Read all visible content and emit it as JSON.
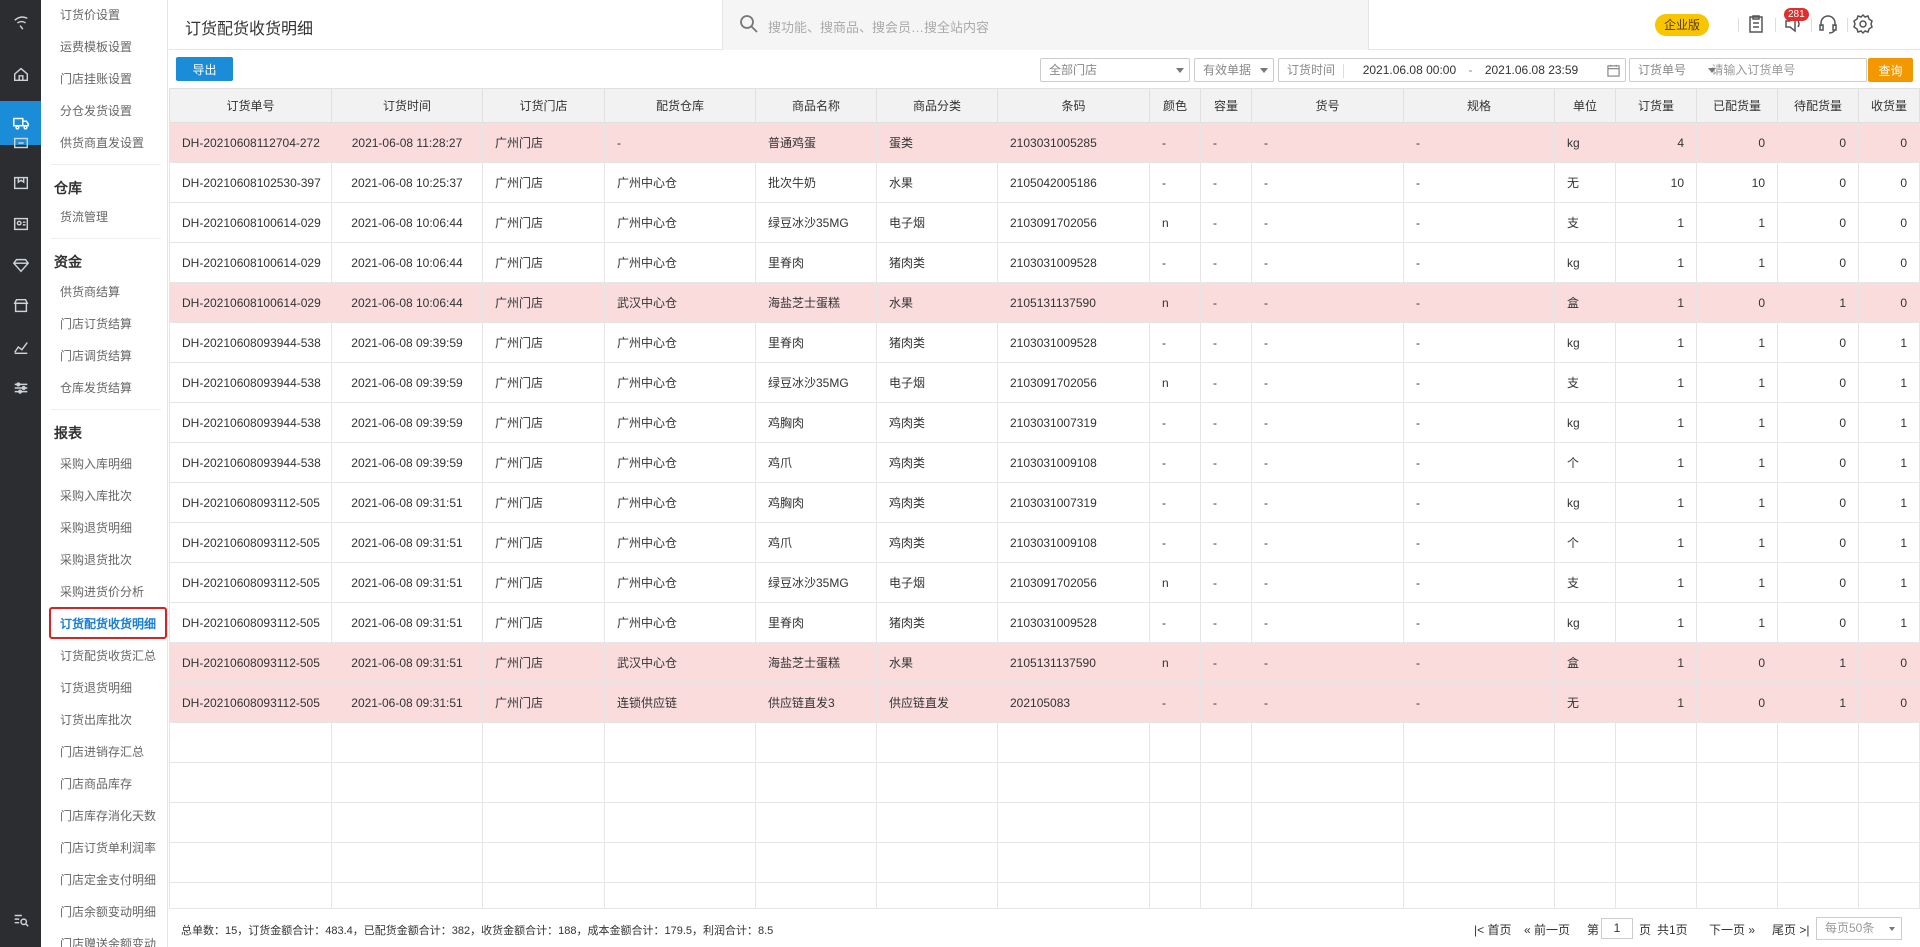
{
  "header": {
    "title": "订货配货收货明细",
    "search_placeholder": "搜功能、搜商品、搜会员…搜全站内容",
    "edition_badge": "企业版",
    "message_count": "281"
  },
  "sidebar": {
    "items_top": [
      "订货价设置",
      "运费模板设置",
      "门店挂账设置",
      "分仓发货设置",
      "供货商直发设置"
    ],
    "group_warehouse": "仓库",
    "items_warehouse": [
      "货流管理"
    ],
    "group_funds": "资金",
    "items_funds": [
      "供货商结算",
      "门店订货结算",
      "门店调货结算",
      "仓库发货结算"
    ],
    "group_reports": "报表",
    "items_reports": [
      "采购入库明细",
      "采购入库批次",
      "采购退货明细",
      "采购退货批次",
      "采购进货价分析"
    ],
    "selected": "订货配货收货明细",
    "items_reports2": [
      "订货配货收货汇总",
      "订货退货明细",
      "订货出库批次",
      "门店进销存汇总",
      "门店商品库存",
      "门店库存消化天数",
      "门店订货单利润率",
      "门店定金支付明细",
      "门店余额变动明细",
      "门店赠送余额变动"
    ]
  },
  "toolbar": {
    "export_label": "导出",
    "store_select": "全部门店",
    "status_select": "有效单据",
    "time_select": "订货时间",
    "date_from": "2021.06.08 00:00",
    "date_sep": "-",
    "date_to": "2021.06.08 23:59",
    "order_select": "订货单号",
    "order_placeholder": "请输入订货单号",
    "query_label": "查询"
  },
  "table": {
    "columns": [
      "订货单号",
      "订货时间",
      "订货门店",
      "配货仓库",
      "商品名称",
      "商品分类",
      "条码",
      "颜色",
      "容量",
      "货号",
      "规格",
      "单位",
      "订货量",
      "已配货量",
      "待配货量",
      "收货量"
    ],
    "rows": [
      {
        "hl": true,
        "cells": [
          "DH-20210608112704-272",
          "2021-06-08 11:28:27",
          "广州门店",
          "-",
          "普通鸡蛋",
          "蛋类",
          "2103031005285",
          "-",
          "-",
          "-",
          "-",
          "kg",
          "4",
          "0",
          "0",
          "0"
        ]
      },
      {
        "hl": false,
        "cells": [
          "DH-20210608102530-397",
          "2021-06-08 10:25:37",
          "广州门店",
          "广州中心仓",
          "批次牛奶",
          "水果",
          "2105042005186",
          "-",
          "-",
          "-",
          "-",
          "无",
          "10",
          "10",
          "0",
          "0"
        ]
      },
      {
        "hl": false,
        "cells": [
          "DH-20210608100614-029",
          "2021-06-08 10:06:44",
          "广州门店",
          "广州中心仓",
          "绿豆冰沙35MG",
          "电子烟",
          "2103091702056",
          "n",
          "-",
          "-",
          "-",
          "支",
          "1",
          "1",
          "0",
          "0"
        ]
      },
      {
        "hl": false,
        "cells": [
          "DH-20210608100614-029",
          "2021-06-08 10:06:44",
          "广州门店",
          "广州中心仓",
          "里脊肉",
          "猪肉类",
          "2103031009528",
          "-",
          "-",
          "-",
          "-",
          "kg",
          "1",
          "1",
          "0",
          "0"
        ]
      },
      {
        "hl": true,
        "cells": [
          "DH-20210608100614-029",
          "2021-06-08 10:06:44",
          "广州门店",
          "武汉中心仓",
          "海盐芝士蛋糕",
          "水果",
          "2105131137590",
          "n",
          "-",
          "-",
          "-",
          "盒",
          "1",
          "0",
          "1",
          "0"
        ]
      },
      {
        "hl": false,
        "cells": [
          "DH-20210608093944-538",
          "2021-06-08 09:39:59",
          "广州门店",
          "广州中心仓",
          "里脊肉",
          "猪肉类",
          "2103031009528",
          "-",
          "-",
          "-",
          "-",
          "kg",
          "1",
          "1",
          "0",
          "1"
        ]
      },
      {
        "hl": false,
        "cells": [
          "DH-20210608093944-538",
          "2021-06-08 09:39:59",
          "广州门店",
          "广州中心仓",
          "绿豆冰沙35MG",
          "电子烟",
          "2103091702056",
          "n",
          "-",
          "-",
          "-",
          "支",
          "1",
          "1",
          "0",
          "1"
        ]
      },
      {
        "hl": false,
        "cells": [
          "DH-20210608093944-538",
          "2021-06-08 09:39:59",
          "广州门店",
          "广州中心仓",
          "鸡胸肉",
          "鸡肉类",
          "2103031007319",
          "-",
          "-",
          "-",
          "-",
          "kg",
          "1",
          "1",
          "0",
          "1"
        ]
      },
      {
        "hl": false,
        "cells": [
          "DH-20210608093944-538",
          "2021-06-08 09:39:59",
          "广州门店",
          "广州中心仓",
          "鸡爪",
          "鸡肉类",
          "2103031009108",
          "-",
          "-",
          "-",
          "-",
          "个",
          "1",
          "1",
          "0",
          "1"
        ]
      },
      {
        "hl": false,
        "cells": [
          "DH-20210608093112-505",
          "2021-06-08 09:31:51",
          "广州门店",
          "广州中心仓",
          "鸡胸肉",
          "鸡肉类",
          "2103031007319",
          "-",
          "-",
          "-",
          "-",
          "kg",
          "1",
          "1",
          "0",
          "1"
        ]
      },
      {
        "hl": false,
        "cells": [
          "DH-20210608093112-505",
          "2021-06-08 09:31:51",
          "广州门店",
          "广州中心仓",
          "鸡爪",
          "鸡肉类",
          "2103031009108",
          "-",
          "-",
          "-",
          "-",
          "个",
          "1",
          "1",
          "0",
          "1"
        ]
      },
      {
        "hl": false,
        "cells": [
          "DH-20210608093112-505",
          "2021-06-08 09:31:51",
          "广州门店",
          "广州中心仓",
          "绿豆冰沙35MG",
          "电子烟",
          "2103091702056",
          "n",
          "-",
          "-",
          "-",
          "支",
          "1",
          "1",
          "0",
          "1"
        ]
      },
      {
        "hl": false,
        "cells": [
          "DH-20210608093112-505",
          "2021-06-08 09:31:51",
          "广州门店",
          "广州中心仓",
          "里脊肉",
          "猪肉类",
          "2103031009528",
          "-",
          "-",
          "-",
          "-",
          "kg",
          "1",
          "1",
          "0",
          "1"
        ]
      },
      {
        "hl": true,
        "cells": [
          "DH-20210608093112-505",
          "2021-06-08 09:31:51",
          "广州门店",
          "武汉中心仓",
          "海盐芝士蛋糕",
          "水果",
          "2105131137590",
          "n",
          "-",
          "-",
          "-",
          "盒",
          "1",
          "0",
          "1",
          "0"
        ]
      },
      {
        "hl": true,
        "cells": [
          "DH-20210608093112-505",
          "2021-06-08 09:31:51",
          "广州门店",
          "连锁供应链",
          "供应链直发3",
          "供应链直发",
          "202105083",
          "-",
          "-",
          "-",
          "-",
          "无",
          "1",
          "0",
          "1",
          "0"
        ]
      }
    ]
  },
  "footer": {
    "summary": "总单数：15，订货金额合计：483.4，已配货金额合计：382，收货金额合计：188，成本金额合计：179.5，利润合计：8.5",
    "first": "首页",
    "prev": "前一页",
    "page_prefix": "第",
    "page": "1",
    "page_suffix": "页",
    "total_pages": "共1页",
    "next": "下一页",
    "last": "尾页",
    "per_page": "每页50条"
  }
}
